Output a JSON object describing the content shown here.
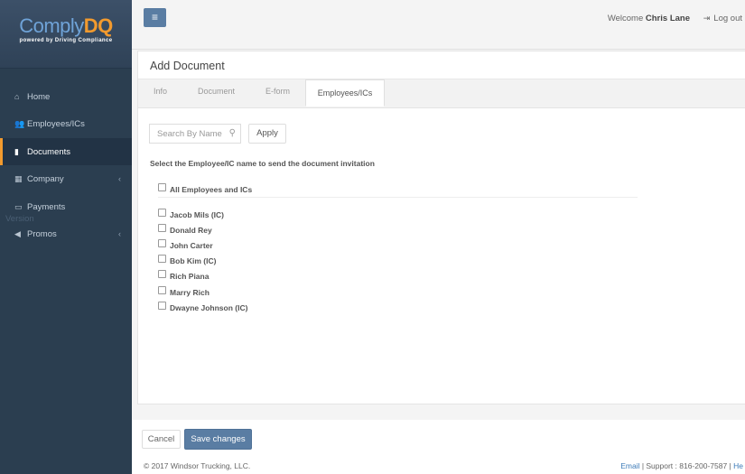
{
  "brand": {
    "logo_part1": "Comply",
    "logo_part2": "DQ",
    "tagline": "powered by Driving Compliance"
  },
  "sidebar": {
    "items": [
      {
        "label": "Home",
        "icon": "home-icon"
      },
      {
        "label": "Employees/ICs",
        "icon": "users-icon"
      },
      {
        "label": "Documents",
        "icon": "file-icon"
      },
      {
        "label": "Company",
        "icon": "building-icon"
      },
      {
        "label": "Payments",
        "icon": "credit-card-icon"
      },
      {
        "label": "Promos",
        "icon": "bullhorn-icon"
      }
    ],
    "ghost_text": "Version"
  },
  "topbar": {
    "welcome_prefix": "Welcome",
    "user_name": "Chris Lane",
    "logout_label": "Log out"
  },
  "page": {
    "title": "Add Document",
    "tabs": [
      {
        "label": "Info"
      },
      {
        "label": "Document"
      },
      {
        "label": "E-form"
      },
      {
        "label": "Employees/ICs"
      }
    ],
    "search_placeholder": "Search By Name",
    "apply_label": "Apply",
    "instruction": "Select the Employee/IC name to send the document invitation",
    "all_label": "All Employees and ICs",
    "employees": [
      "Jacob Mils (IC)",
      "Donald Rey",
      "John Carter",
      "Bob Kim (IC)",
      "Rich Piana",
      "Marry Rich",
      "Dwayne Johnson (IC)"
    ]
  },
  "footer": {
    "cancel_label": "Cancel",
    "save_label": "Save changes",
    "copyright": "© 2017 Windsor Trucking, LLC.",
    "email_link": "Email",
    "sep1": " | ",
    "support_text": "Support : 816-200-7587",
    "sep2": " | ",
    "help_link": "He"
  },
  "colors": {
    "accent": "#f29a2e",
    "primary_button": "#5a7da3",
    "sidebar_bg": "#2b3e50"
  }
}
